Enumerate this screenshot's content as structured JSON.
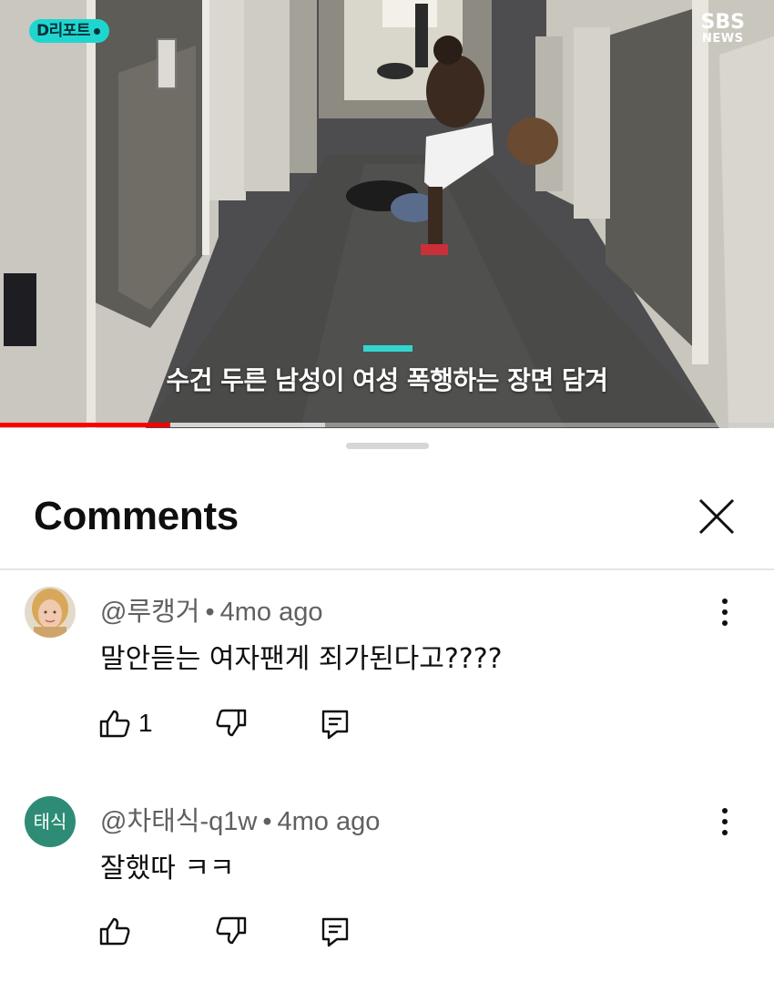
{
  "video": {
    "channel_badge": "D리포트",
    "logo_top": "SBS",
    "logo_bottom": "NEWS",
    "caption": "수건 두른 남성이 여성 폭행하는 장면 담겨",
    "progress_played": 0.22,
    "progress_buffered": 0.42,
    "accent_color": "#33d6cf",
    "progress_color": "#ff0000"
  },
  "sheet": {
    "title": "Comments",
    "close_icon": "close-icon"
  },
  "comments": [
    {
      "author": "@루캥거",
      "separator": "•",
      "time": "4mo ago",
      "text": "말안듣는 여자팬게 죄가된다고????",
      "likes": "1",
      "avatar": "photo"
    },
    {
      "author": "@차태식-q1w",
      "separator": "•",
      "time": "4mo ago",
      "text": "잘했따 ㅋㅋ",
      "likes": "",
      "avatar_text": "태식",
      "avatar_color": "#2e8c76"
    }
  ],
  "icons": {
    "like": "thumbs-up-icon",
    "dislike": "thumbs-down-icon",
    "reply": "reply-icon",
    "more": "more-vertical-icon"
  }
}
